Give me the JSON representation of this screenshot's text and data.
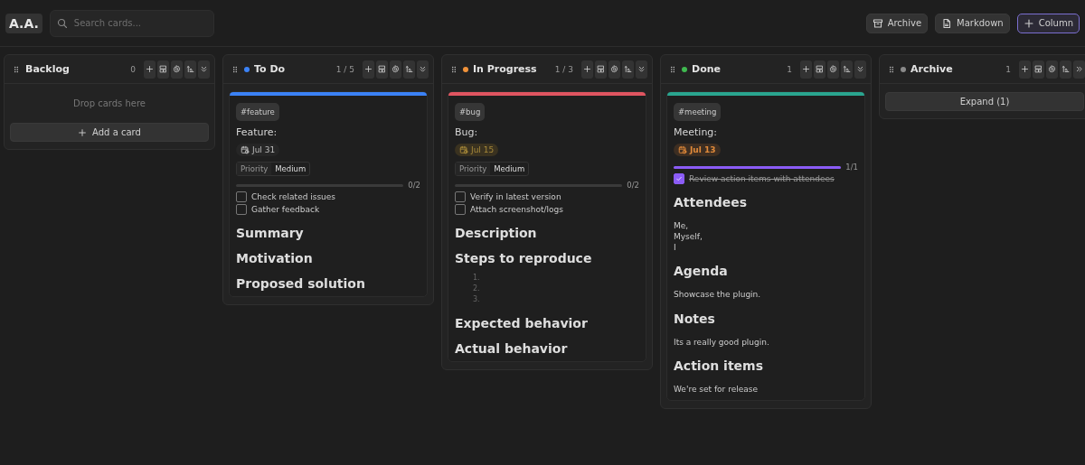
{
  "header": {
    "logo": "A.A.",
    "search": {
      "placeholder": "Search cards..."
    },
    "buttons": [
      {
        "kind": "archive",
        "label": "Archive"
      },
      {
        "kind": "markdown",
        "label": "Markdown"
      },
      {
        "kind": "add",
        "label": "Column"
      }
    ]
  },
  "columns": [
    {
      "kind": "empty",
      "title": "Backlog",
      "count": "0",
      "empty_text": "Drop cards here",
      "add_label": "Add a card"
    },
    {
      "kind": "cards",
      "title": "To Do",
      "color": "#3b82f6",
      "count": "1 / 5",
      "cards": [
        {
          "color": "#3b82f6",
          "tag": "#feature",
          "title": "Feature:",
          "date": {
            "text": "Jul 31",
            "kind": "normal"
          },
          "priority": {
            "label": "Priority",
            "value": "Medium"
          },
          "progress": {
            "text": "0/2"
          },
          "checklist": [
            {
              "text": "Check related issues",
              "checked": false
            },
            {
              "text": "Gather feedback",
              "checked": false
            }
          ],
          "content": [
            {
              "kind": "heading",
              "text": "Summary"
            },
            {
              "kind": "heading",
              "text": "Motivation"
            },
            {
              "kind": "heading",
              "text": "Proposed solution"
            }
          ]
        }
      ]
    },
    {
      "kind": "cards",
      "title": "In Progress",
      "color": "#f0923a",
      "count": "1 / 3",
      "cards": [
        {
          "color": "#e05561",
          "tag": "#bug",
          "title": "Bug:",
          "date": {
            "text": "Jul 15",
            "kind": "soon"
          },
          "priority": {
            "label": "Priority",
            "value": "Medium"
          },
          "progress": {
            "text": "0/2"
          },
          "checklist": [
            {
              "text": "Verify in latest version",
              "checked": false
            },
            {
              "text": "Attach screenshot/logs",
              "checked": false
            }
          ],
          "content": [
            {
              "kind": "heading",
              "text": "Description"
            },
            {
              "kind": "heading",
              "text": "Steps to reproduce"
            },
            {
              "kind": "numbered",
              "items": [
                "1.",
                "2.",
                "3."
              ]
            },
            {
              "kind": "heading",
              "text": "Expected behavior"
            },
            {
              "kind": "heading",
              "text": "Actual behavior"
            }
          ]
        }
      ]
    },
    {
      "kind": "cards",
      "title": "Done",
      "color": "#3fb950",
      "count": "1",
      "cards": [
        {
          "color": "#2aa58f",
          "tag": "#meeting",
          "title": "Meeting:",
          "date": {
            "text": "Jul 13",
            "kind": "overdue"
          },
          "progress": {
            "level": 1,
            "text": "1/1"
          },
          "checklist": [
            {
              "text": "Review action items with attendees",
              "checked": true
            }
          ],
          "content": [
            {
              "kind": "heading",
              "text": "Attendees"
            },
            {
              "kind": "lines",
              "items": [
                "Me,",
                "Myself,",
                "I"
              ]
            },
            {
              "kind": "heading",
              "text": "Agenda"
            },
            {
              "kind": "paragraph",
              "text": "Showcase the plugin."
            },
            {
              "kind": "heading",
              "text": "Notes"
            },
            {
              "kind": "paragraph",
              "text": "Its a really good plugin."
            },
            {
              "kind": "heading",
              "text": "Action items"
            },
            {
              "kind": "paragraph",
              "text": "We're set for release"
            }
          ]
        }
      ]
    },
    {
      "kind": "collapsed",
      "title": "Archive",
      "color": "#8a8a8a",
      "count": "1",
      "expand_label": "Expand (1)"
    }
  ]
}
